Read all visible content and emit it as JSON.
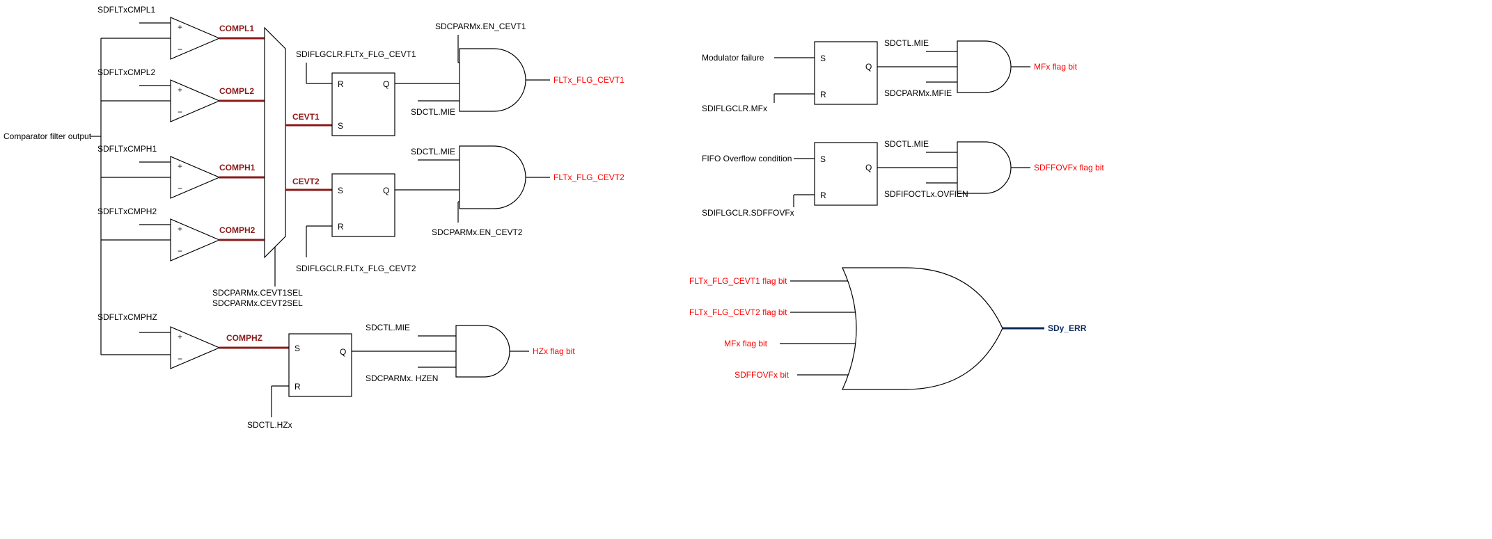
{
  "left": {
    "input_main": "Comparator filter output",
    "comp_inputs": {
      "cmpl1": "SDFLTxCMPL1",
      "cmpl2": "SDFLTxCMPL2",
      "cmph1": "SDFLTxCMPH1",
      "cmph2": "SDFLTxCMPH2",
      "cmphz": "SDFLTxCMPHZ"
    },
    "comp_names": {
      "compl1": "COMPL1",
      "compl2": "COMPL2",
      "comph1": "COMPH1",
      "comph2": "COMPH2",
      "comphz": "COMPHZ"
    },
    "mux_sel1": "SDCPARMx.CEVT1SEL",
    "mux_sel2": "SDCPARMx.CEVT2SEL",
    "cevt1": "CEVT1",
    "cevt2": "CEVT2",
    "sr_labels": {
      "s": "S",
      "r": "R",
      "q": "Q"
    },
    "clr_cevt1": "SDIFLGCLR.FLTx_FLG_CEVT1",
    "clr_cevt2": "SDIFLGCLR.FLTx_FLG_CEVT2",
    "en_cevt1": "SDCPARMx.EN_CEVT1",
    "en_cevt2": "SDCPARMx.EN_CEVT2",
    "mie": "SDCTL.MIE",
    "out_cevt1": "FLTx_FLG_CEVT1",
    "out_cevt2": "FLTx_FLG_CEVT2",
    "hz_block": {
      "hzen": "SDCPARMx. HZEN",
      "mie": "SDCTL.MIE",
      "clr": "SDCTL.HZx",
      "out": "HZx flag bit"
    }
  },
  "right_top": {
    "mod_fail": "Modulator failure",
    "clr_mf": "SDIFLGCLR.MFx",
    "mie": "SDCTL.MIE",
    "mfie": "SDCPARMx.MFIE",
    "out_mf": "MFx flag bit",
    "fifo_ovf": "FIFO Overflow condition",
    "clr_ovf": "SDIFLGCLR.SDFFOVFx",
    "ovfien": "SDFIFOCTLx.OVFIEN",
    "out_ovf": "SDFFOVFx flag bit"
  },
  "or_block": {
    "in1": "FLTx_FLG_CEVT1  flag bit",
    "in2": "FLTx_FLG_CEVT2  flag bit",
    "in3": "MFx flag bit",
    "in4": "SDFFOVFx bit",
    "out": "SDy_ERR"
  }
}
